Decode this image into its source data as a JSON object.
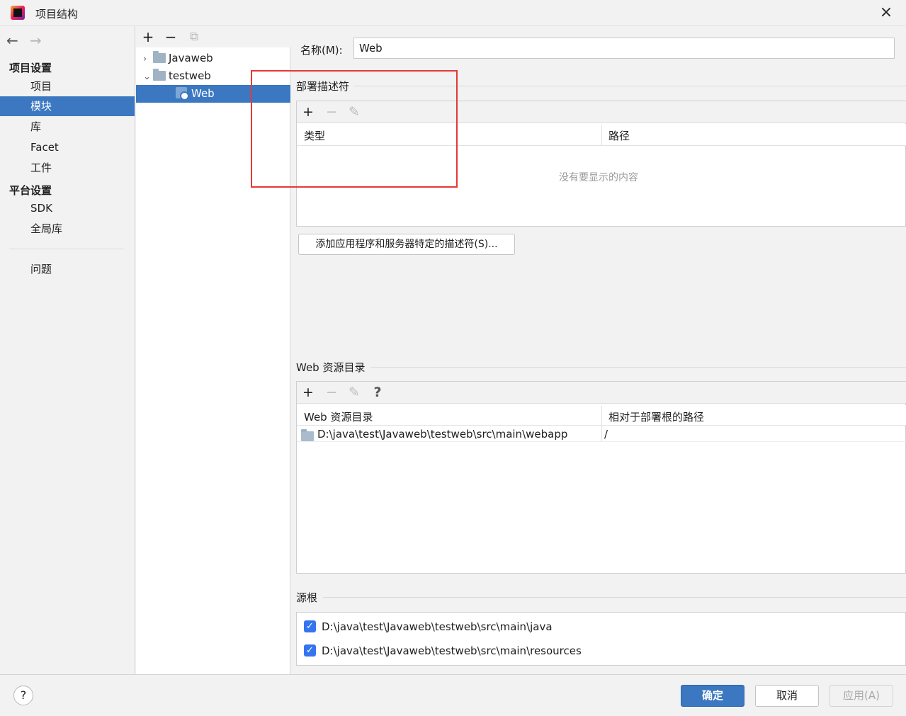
{
  "window": {
    "title": "项目结构",
    "close_icon": "×"
  },
  "nav": {
    "back_icon": "←",
    "forward_icon": "→",
    "project_settings_heading": "项目设置",
    "platform_settings_heading": "平台设置",
    "items": [
      {
        "label": "项目",
        "selected": false
      },
      {
        "label": "模块",
        "selected": true
      },
      {
        "label": "库",
        "selected": false
      },
      {
        "label": "Facet",
        "selected": false
      },
      {
        "label": "工件",
        "selected": false
      },
      {
        "label": "SDK",
        "selected": false
      },
      {
        "label": "全局库",
        "selected": false
      },
      {
        "label": "问题",
        "selected": false
      }
    ]
  },
  "tree": {
    "toolbar": {
      "add": "+",
      "remove": "−",
      "copy": "⧉"
    },
    "nodes": [
      {
        "label": "Javaweb",
        "chevron": "›",
        "expanded": false
      },
      {
        "label": "testweb",
        "chevron": "⌄",
        "expanded": true
      },
      {
        "label": "Web",
        "selected": true
      }
    ]
  },
  "module": {
    "name_label": "名称(M):",
    "name_value": "Web"
  },
  "descriptors": {
    "title": "部署描述符",
    "toolbar": {
      "add": "+",
      "remove": "−",
      "edit": "✎"
    },
    "columns": [
      "类型",
      "路径"
    ],
    "empty_text": "没有要显示的内容",
    "add_button": "添加应用程序和服务器特定的描述符(S)..."
  },
  "web_resources": {
    "title": "Web 资源目录",
    "toolbar": {
      "add": "+",
      "remove": "−",
      "edit": "✎",
      "help": "?"
    },
    "columns": [
      "Web 资源目录",
      "相对于部署根的路径"
    ],
    "rows": [
      {
        "dir": "D:\\java\\test\\Javaweb\\testweb\\src\\main\\webapp",
        "path": "/"
      }
    ]
  },
  "source_roots": {
    "title": "源根",
    "items": [
      {
        "path": "D:\\java\\test\\Javaweb\\testweb\\src\\main\\java",
        "checked": true
      },
      {
        "path": "D:\\java\\test\\Javaweb\\testweb\\src\\main\\resources",
        "checked": true
      }
    ]
  },
  "footer": {
    "help": "?",
    "ok": "确定",
    "cancel": "取消",
    "apply": "应用(A)"
  },
  "colors": {
    "accent": "#3b78c1",
    "checkbox": "#3574f0",
    "highlight_box": "#e53935"
  }
}
